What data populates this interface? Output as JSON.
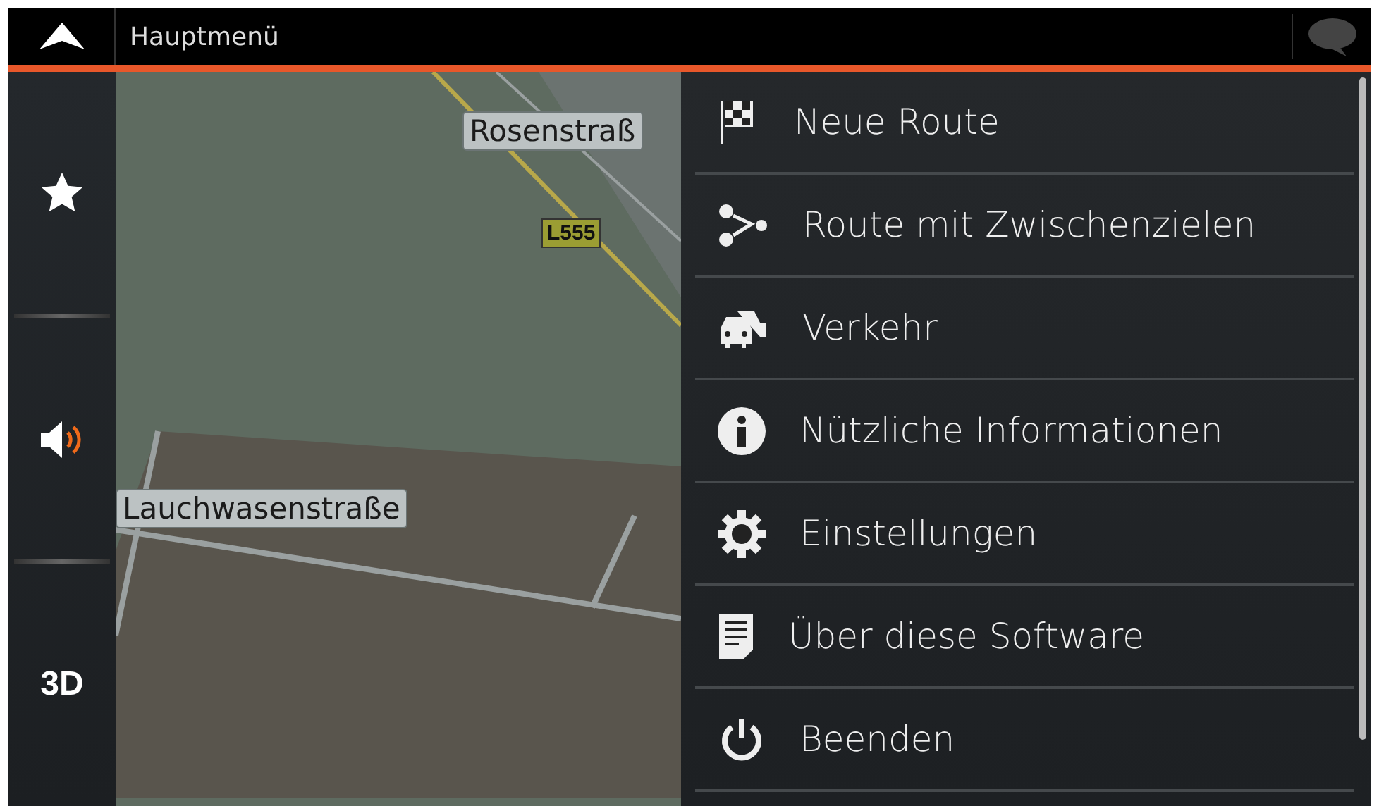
{
  "header": {
    "title": "Hauptmenü"
  },
  "sidebar": {
    "items": [
      {
        "kind": "favorites"
      },
      {
        "kind": "sound"
      },
      {
        "kind": "view",
        "label": "3D"
      }
    ]
  },
  "map": {
    "labels": [
      {
        "kind": "street",
        "text": "Rosenstraß"
      },
      {
        "kind": "road-number",
        "text": "L555"
      },
      {
        "kind": "street",
        "text": "Lauchwasenstraße"
      }
    ]
  },
  "menu": {
    "items": [
      {
        "label": "Neue Route"
      },
      {
        "label": "Route mit Zwischenzielen"
      },
      {
        "label": "Verkehr"
      },
      {
        "label": "Nützliche Informationen"
      },
      {
        "label": "Einstellungen"
      },
      {
        "label": "Über diese Software"
      },
      {
        "label": "Beenden"
      }
    ]
  }
}
